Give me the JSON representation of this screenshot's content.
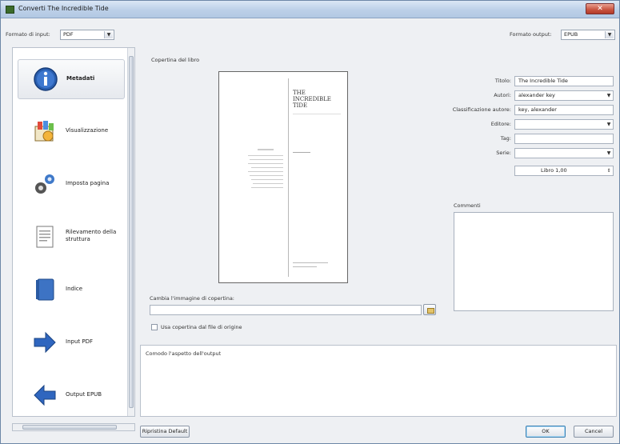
{
  "window": {
    "title": "Converti The Incredible Tide",
    "close_glyph": "✕"
  },
  "top": {
    "input_format_label": "Formato di input:",
    "input_format_value": "PDF",
    "output_format_label": "Formato output:",
    "output_format_value": "EPUB"
  },
  "sidebar": {
    "items": [
      {
        "label": "Metadati",
        "icon": "info-icon"
      },
      {
        "label": "Visualizzazione",
        "icon": "palette-icon"
      },
      {
        "label": "Imposta pagina",
        "icon": "gears-icon"
      },
      {
        "label": "Rilevamento della struttura",
        "icon": "document-icon"
      },
      {
        "label": "Indice",
        "icon": "book-icon"
      },
      {
        "label": "Input PDF",
        "icon": "arrow-right-icon"
      },
      {
        "label": "Output EPUB",
        "icon": "arrow-left-icon"
      }
    ]
  },
  "metadata": {
    "cover_group_label": "Copertina del libro",
    "cover": {
      "title_lines": [
        "THE",
        "INCREDIBLE",
        "TIDE"
      ]
    },
    "fields": {
      "title_label": "Titolo:",
      "title_value": "The Incredible Tide",
      "authors_label": "Autori:",
      "authors_value": "alexander key",
      "author_sort_label": "Classificazione autore:",
      "author_sort_value": "key, alexander",
      "publisher_label": "Editore:",
      "publisher_value": "",
      "tags_label": "Tag:",
      "tags_value": "",
      "series_label": "Serie:",
      "series_value": "",
      "book_number_value": "Libro 1,00"
    },
    "comments_label": "Commenti",
    "change_cover_label": "Cambia l'immagine di copertina:",
    "use_cover_label": "Usa copertina dal file di origine"
  },
  "description": {
    "label": "Comodo l'aspetto dell'output"
  },
  "buttons": {
    "restore_defaults": "Ripristina Default",
    "ok": "OK",
    "cancel": "Cancel"
  }
}
